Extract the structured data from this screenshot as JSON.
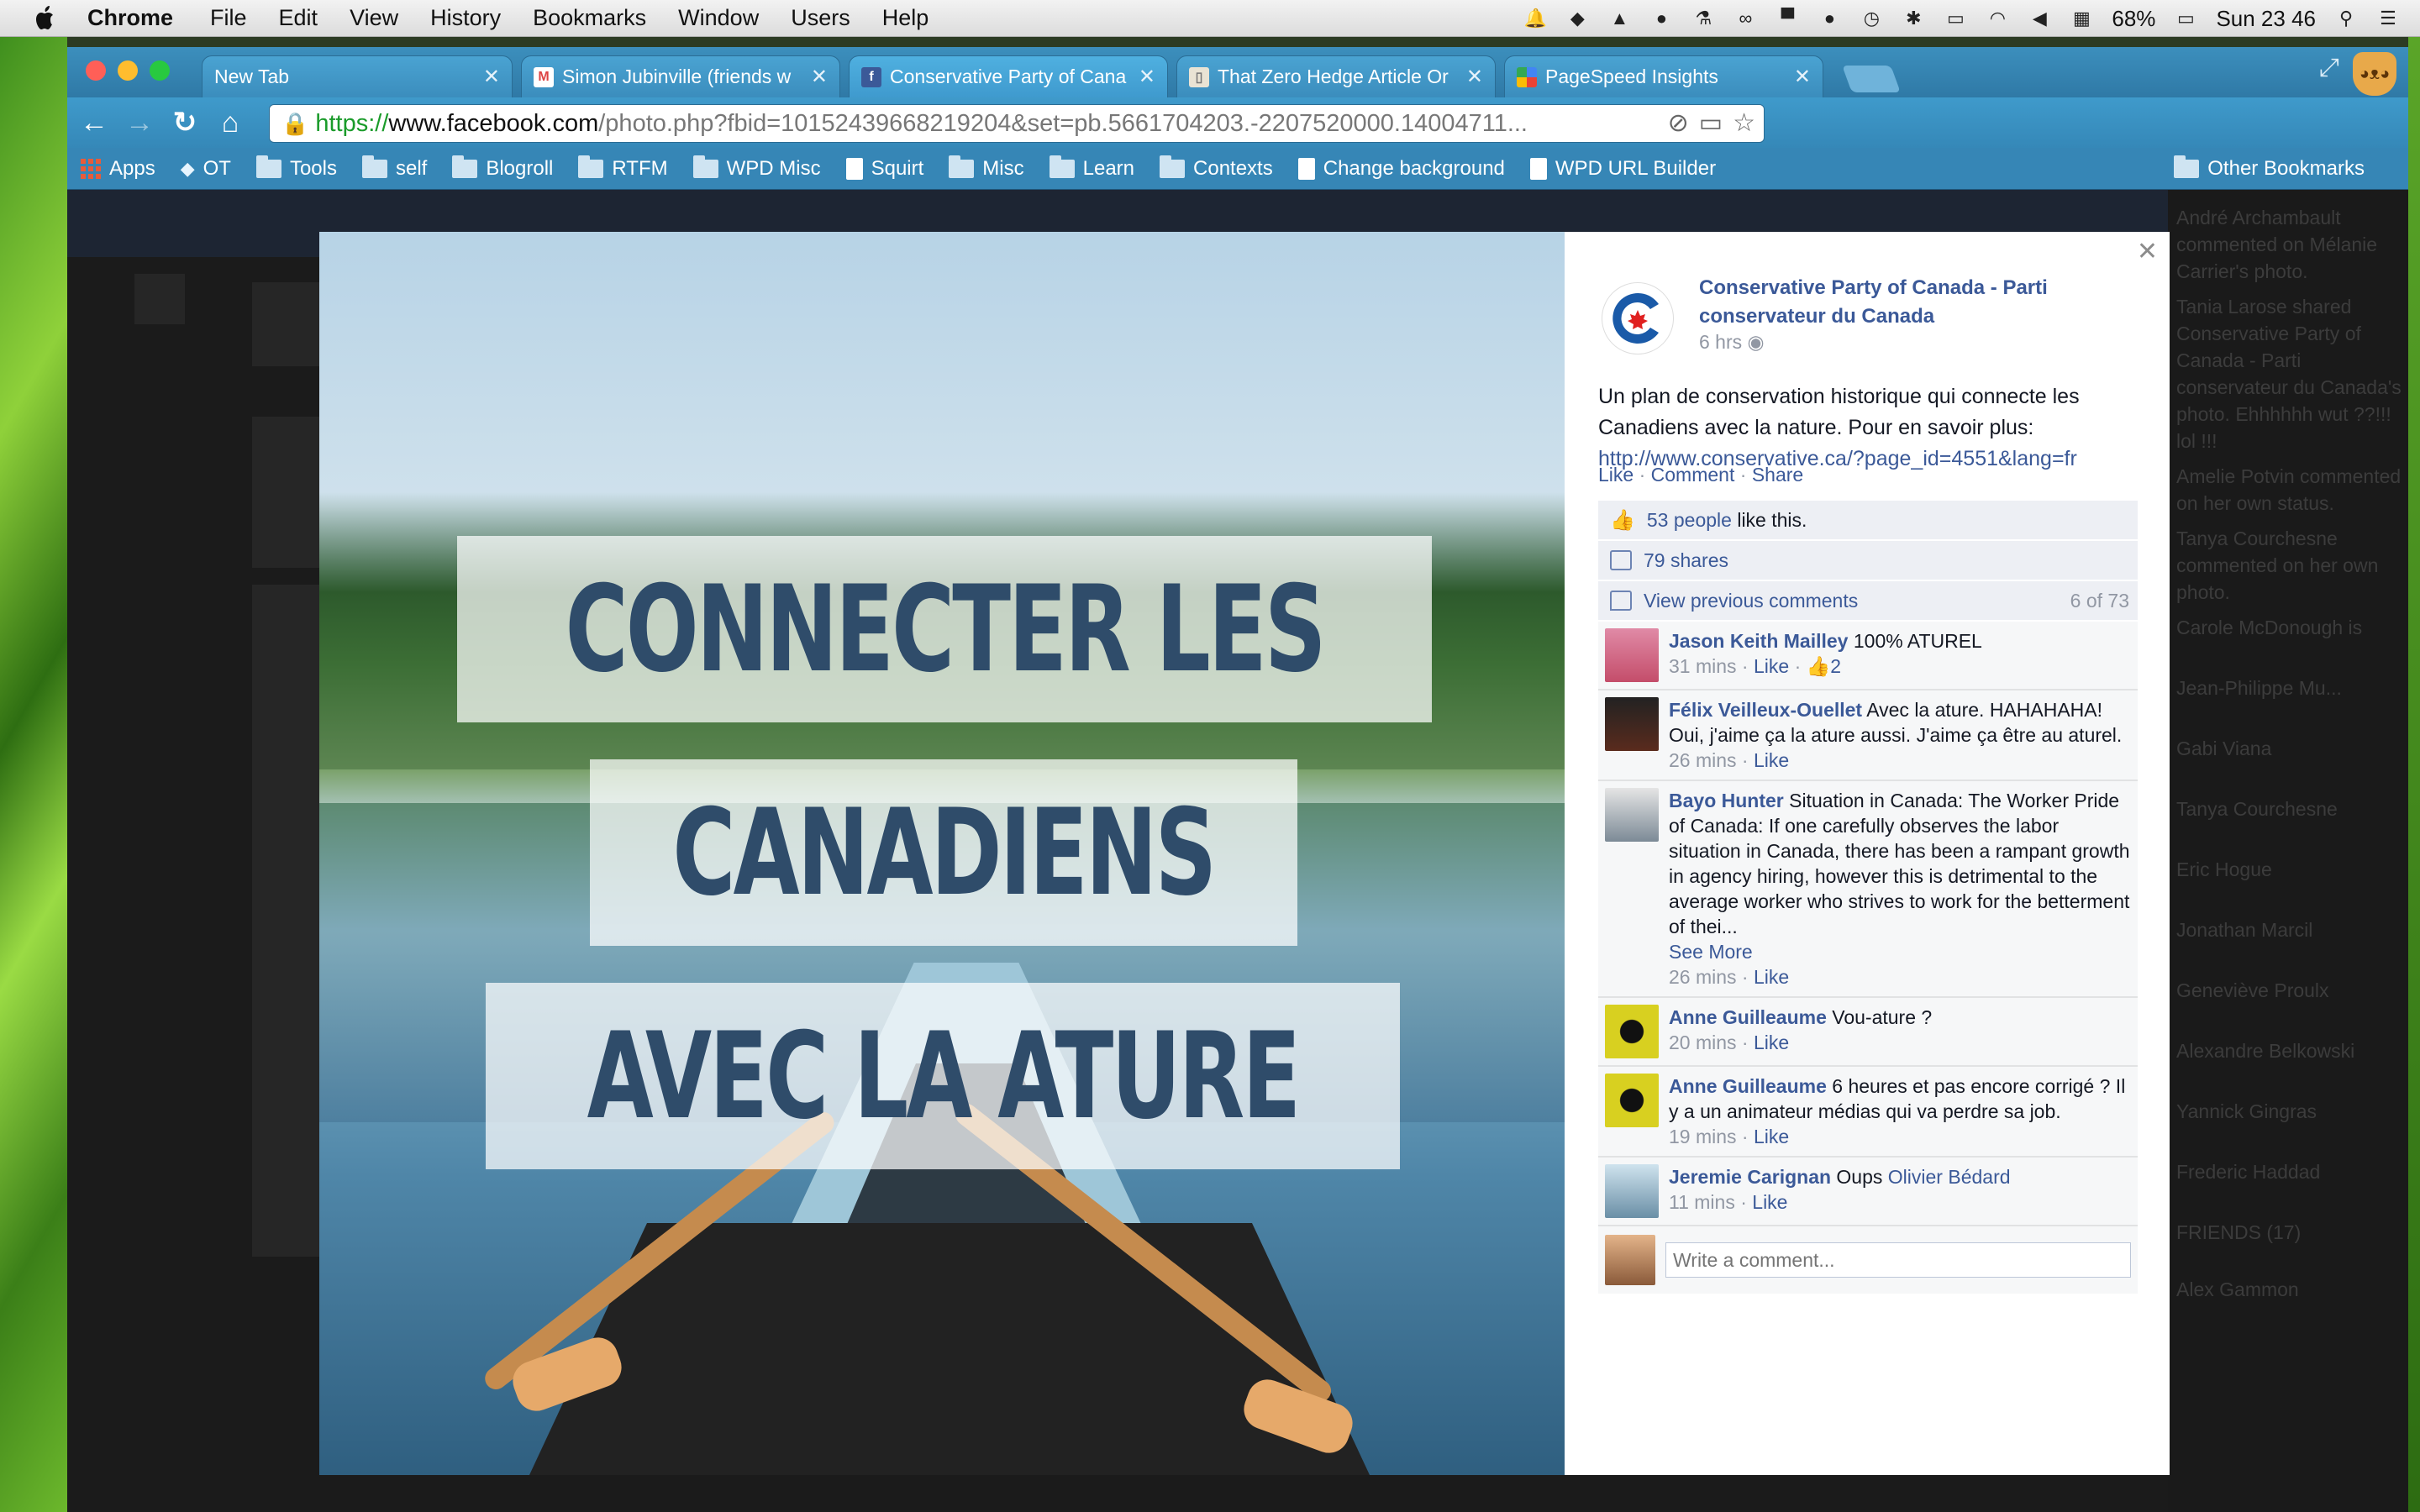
{
  "menubar": {
    "app": "Chrome",
    "items": [
      "File",
      "Edit",
      "View",
      "History",
      "Bookmarks",
      "Window",
      "Users",
      "Help"
    ],
    "battery": "68%",
    "clock": "Sun 23 46"
  },
  "tabs": [
    {
      "title": "New Tab",
      "favicon": "blank-page-icon"
    },
    {
      "title": "Simon Jubinville (friends w",
      "favicon": "gmail-icon"
    },
    {
      "title": "Conservative Party of Cana",
      "favicon": "facebook-icon"
    },
    {
      "title": "That Zero Hedge Article Or",
      "favicon": "page-icon"
    },
    {
      "title": "PageSpeed Insights",
      "favicon": "pagespeed-icon"
    }
  ],
  "toolbar": {
    "url_scheme": "https://",
    "url_domain": "www.facebook.com",
    "url_rest": "/photo.php?fbid=10152439668219204&set=pb.5661704203.-2207520000.14004711..."
  },
  "bookmarks": {
    "items": [
      "Apps",
      "OT",
      "Tools",
      "self",
      "Blogroll",
      "RTFM",
      "WPD Misc",
      "Squirt",
      "Misc",
      "Learn",
      "Contexts",
      "Change background",
      "WPD URL Builder"
    ],
    "other": "Other Bookmarks"
  },
  "ticker": {
    "items": [
      "André Archambault",
      "commented on Mélanie",
      "Carrier's photo.",
      "Tania Larose shared",
      "Conservative Party of",
      "Canada - Parti",
      "conservateur du Canada's",
      "photo. Ehhhhhh wut ??!!!",
      "lol !!!",
      "Amelie Potvin commented",
      "on her own status.",
      "Tanya Courchesne",
      "commented on her own",
      "photo.",
      "Carole McDonough is",
      "Jean-Philippe Mu...",
      "Gabi Viana",
      "Tanya Courchesne",
      "Eric Hogue",
      "Jonathan Marcil",
      "Geneviève Proulx",
      "Alexandre Belkowski",
      "Yannick Gingras",
      "Frederic Haddad",
      "FRIENDS (17)",
      "Alex Gammon"
    ]
  },
  "photo": {
    "caption_lines": [
      "CONNECTER LES",
      "CANADIENS",
      "AVEC LA ATURE"
    ]
  },
  "post": {
    "author": "Conservative Party of Canada - Parti conservateur du Canada",
    "time": "6 hrs",
    "text": "Un plan de conservation historique qui connecte les Canadiens avec la nature. Pour en savoir plus: ",
    "link": "http://www.conservative.ca/?page_id=4551&lang=fr",
    "actions": [
      "Like",
      "Comment",
      "Share"
    ],
    "likes_count": "53 people",
    "likes_suffix": "like this.",
    "shares": "79 shares",
    "view_previous": "View previous comments",
    "comment_count": "6 of 73"
  },
  "comments": [
    {
      "name": "Jason Keith Mailley",
      "text": "100% ATUREL",
      "time": "31 mins",
      "like": "Like",
      "likes": "2",
      "avatar": "#c44d6a"
    },
    {
      "name": "Félix Veilleux-Ouellet",
      "text": "Avec la ature. HAHAHAHA! Oui, j'aime ça la ature aussi. J'aime ça être au aturel.",
      "time": "26 mins",
      "like": "Like",
      "avatar": "#5a2b1d"
    },
    {
      "name": "Bayo Hunter",
      "text": "Situation in Canada: The Worker Pride of Canada: If one carefully observes the labor situation in Canada, there has been a rampant growth in agency hiring, however this is detrimental to the average worker who strives to work for the betterment of thei...",
      "see_more": "See More",
      "time": "26 mins",
      "like": "Like",
      "avatar": "#7c8a96"
    },
    {
      "name": "Anne Guilleaume",
      "text": "Vou-ature ?",
      "time": "20 mins",
      "like": "Like",
      "avatar": "#d8d020"
    },
    {
      "name": "Anne Guilleaume",
      "text": "6 heures et pas encore corrigé ? Il y a un animateur médias qui va perdre sa job.",
      "time": "19 mins",
      "like": "Like",
      "avatar": "#d8d020"
    },
    {
      "name": "Jeremie Carignan",
      "text": "Oups",
      "mention": "Olivier Bédard",
      "time": "11 mins",
      "like": "Like",
      "avatar": "#6a8fa6"
    }
  ],
  "composer": {
    "placeholder": "Write a comment..."
  },
  "colors": {
    "fb_blue": "#3b5998",
    "chrome_tab": "#3f9ace",
    "caption_text": "#2f4c6a"
  }
}
